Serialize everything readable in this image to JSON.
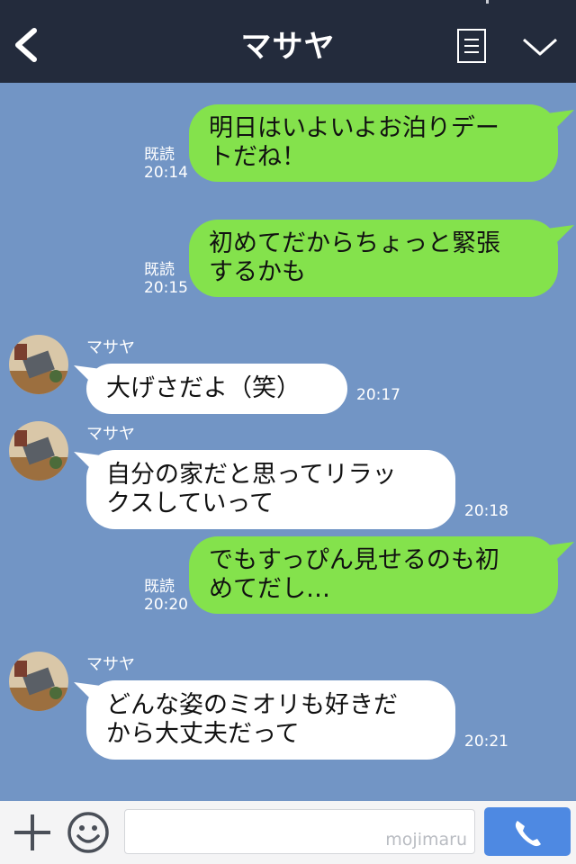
{
  "header": {
    "title": "マサヤ",
    "back_icon": "chevron-left-icon",
    "menu_icon": "list-icon",
    "collapse_icon": "chevron-down-icon"
  },
  "messages": [
    {
      "from": "me",
      "lines": [
        "明日はいよいよお泊りデー",
        "トだね！"
      ],
      "read": "既読",
      "time": "20:14"
    },
    {
      "from": "me",
      "lines": [
        "初めてだからちょっと緊張",
        "するかも"
      ],
      "read": "既読",
      "time": "20:15"
    },
    {
      "from": "them",
      "sender": "マサヤ",
      "lines": [
        "大げさだよ（笑）"
      ],
      "time": "20:17"
    },
    {
      "from": "them",
      "sender": "マサヤ",
      "lines": [
        "自分の家だと思ってリラッ",
        "クスしていって"
      ],
      "time": "20:18"
    },
    {
      "from": "me",
      "lines": [
        "でもすっぴん見せるのも初",
        "めてだし…"
      ],
      "read": "既読",
      "time": "20:20"
    },
    {
      "from": "them",
      "sender": "マサヤ",
      "lines": [
        "どんな姿のミオリも好きだ",
        "から大丈夫だって"
      ],
      "time": "20:21"
    }
  ],
  "footer": {
    "plus_icon": "plus-icon",
    "emoji_icon": "emoji-icon",
    "input_value": "",
    "watermark": "mojimaru",
    "call_icon": "phone-icon"
  },
  "colors": {
    "header_bg": "#232b3c",
    "chat_bg": "#7295c5",
    "my_bubble": "#84e24c",
    "their_bubble": "#ffffff",
    "call_button": "#4e89e2"
  }
}
